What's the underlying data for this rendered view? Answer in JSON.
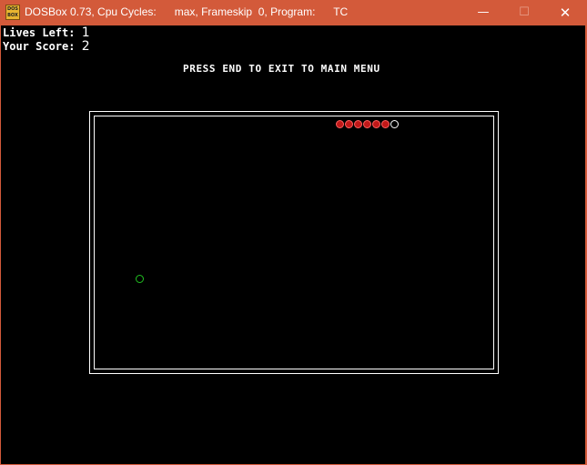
{
  "window": {
    "title": "DOSBox 0.73, Cpu Cycles:      max, Frameskip  0, Program:      TC",
    "icon_top": "DOS",
    "icon_bottom": "BOX",
    "minimize_icon": "minimize-icon",
    "maximize_icon": "maximize-icon",
    "close_icon": "close-icon",
    "minimize_glyph": "—",
    "maximize_glyph": "☐",
    "close_glyph": "✕"
  },
  "game": {
    "lives_label": "Lives Left: ",
    "lives_value": "1",
    "score_label": "Your Score: ",
    "score_value": "2",
    "message": "PRESS END TO EXIT TO MAIN MENU",
    "colors": {
      "snake_body": "#c01818",
      "snake_head_outline": "#ffffff",
      "food_outline": "#20c020",
      "background": "#000000",
      "border": "#ffffff"
    },
    "snake_length": 7
  }
}
